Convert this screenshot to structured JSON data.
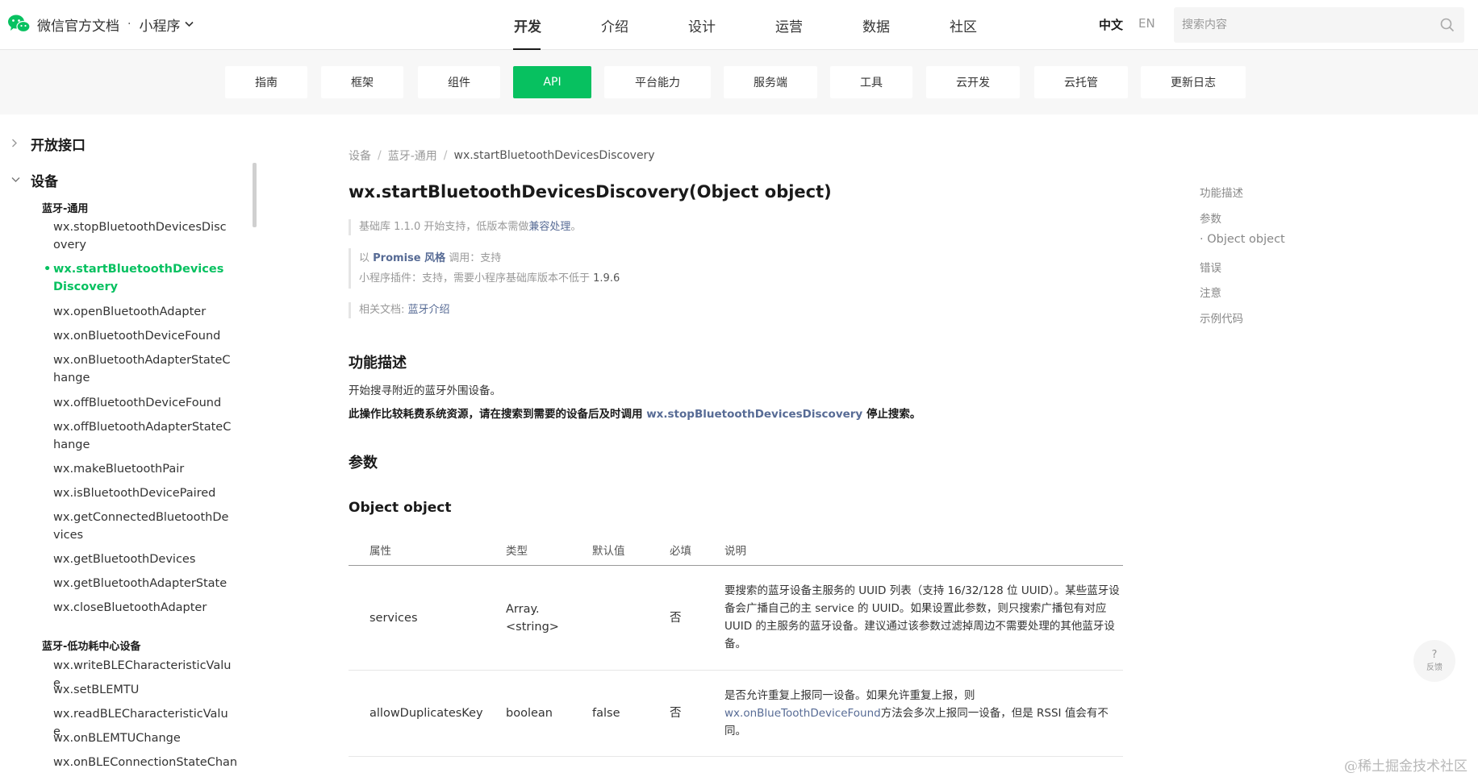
{
  "header": {
    "brand_title": "微信官方文档",
    "brand_dot": "·",
    "brand_sub": "小程序",
    "nav": [
      {
        "label": "开发",
        "active": true
      },
      {
        "label": "介绍"
      },
      {
        "label": "设计"
      },
      {
        "label": "运营"
      },
      {
        "label": "数据"
      },
      {
        "label": "社区"
      }
    ],
    "lang_zh": "中文",
    "lang_en": "EN",
    "search_placeholder": "搜索内容",
    "brand_color": "#07c160"
  },
  "subnav": {
    "tabs": [
      {
        "label": "指南"
      },
      {
        "label": "框架"
      },
      {
        "label": "组件"
      },
      {
        "label": "API",
        "active": true
      },
      {
        "label": "平台能力"
      },
      {
        "label": "服务端"
      },
      {
        "label": "工具"
      },
      {
        "label": "云开发"
      },
      {
        "label": "云托管"
      },
      {
        "label": "更新日志"
      }
    ]
  },
  "sidebar": {
    "sections": [
      {
        "label": "开放接口",
        "expanded": false
      },
      {
        "label": "设备",
        "expanded": true
      }
    ],
    "group1": "蓝牙-通用",
    "items1": [
      "wx.stopBluetoothDevicesDiscovery",
      "wx.startBluetoothDevicesDiscovery",
      "wx.openBluetoothAdapter",
      "wx.onBluetoothDeviceFound",
      "wx.onBluetoothAdapterStateChange",
      "wx.offBluetoothDeviceFound",
      "wx.offBluetoothAdapterStateChange",
      "wx.makeBluetoothPair",
      "wx.isBluetoothDevicePaired",
      "wx.getConnectedBluetoothDevices",
      "wx.getBluetoothDevices",
      "wx.getBluetoothAdapterState",
      "wx.closeBluetoothAdapter"
    ],
    "group2": "蓝牙-低功耗中心设备",
    "items2": [
      "wx.writeBLECharacteristicValue",
      "wx.setBLEMTU",
      "wx.readBLECharacteristicValue",
      "wx.onBLEMTUChange",
      "wx.onBLEConnectionStateChan"
    ]
  },
  "main": {
    "breadcrumb": [
      "设备",
      "蓝牙-通用",
      "wx.startBluetoothDevicesDiscovery"
    ],
    "breadcrumb_sep": "/",
    "title": "wx.startBluetoothDevicesDiscovery(Object object)",
    "note1_text": "基础库 1.1.0 开始支持，低版本需做",
    "note1_link": "兼容处理",
    "note1_end": "。",
    "note2_prefix": "以",
    "note2_strong": "Promise 风格",
    "note2_mid": "调用：支持",
    "note2_line2": "小程序插件：支持，需要小程序基础库版本不低于",
    "note2_version": "1.9.6",
    "note3_text": "相关文档:",
    "note3_link": "蓝牙介绍",
    "sec_desc": "功能描述",
    "desc_p1": "开始搜寻附近的蓝牙外围设备。",
    "desc_p2_pre": "此操作比较耗费系统资源，请在搜索到需要的设备后及时调用",
    "desc_p2_link": "wx.stopBluetoothDevicesDiscovery",
    "desc_p2_post": "停止搜索。",
    "sec_params": "参数",
    "sub_obj": "Object object",
    "table": {
      "headers": [
        "属性",
        "类型",
        "默认值",
        "必填",
        "说明"
      ],
      "rows": [
        {
          "prop": "services",
          "type_l1": "Array.",
          "type_l2": "<string>",
          "default": "",
          "required": "否",
          "desc": "要搜索的蓝牙设备主服务的 UUID 列表（支持 16/32/128 位 UUID）。某些蓝牙设备会广播自己的主 service 的 UUID。如果设置此参数，则只搜索广播包有对应 UUID 的主服务的蓝牙设备。建议通过该参数过滤掉周边不需要处理的其他蓝牙设备。"
        },
        {
          "prop": "allowDuplicatesKey",
          "type_l1": "boolean",
          "type_l2": "",
          "default": "false",
          "required": "否",
          "desc_pre": "是否允许重复上报同一设备。如果允许重复上报，则",
          "desc_link": "wx.onBlueToothDeviceFound",
          "desc_post": "方法会多次上报同一设备，但是 RSSI 值会有不同。"
        }
      ]
    }
  },
  "toc": [
    "功能描述",
    "参数",
    "· Object object",
    "错误",
    "注意",
    "示例代码"
  ],
  "feedback": {
    "icon": "?",
    "label": "反馈"
  },
  "watermark": "@稀土掘金技术社区"
}
